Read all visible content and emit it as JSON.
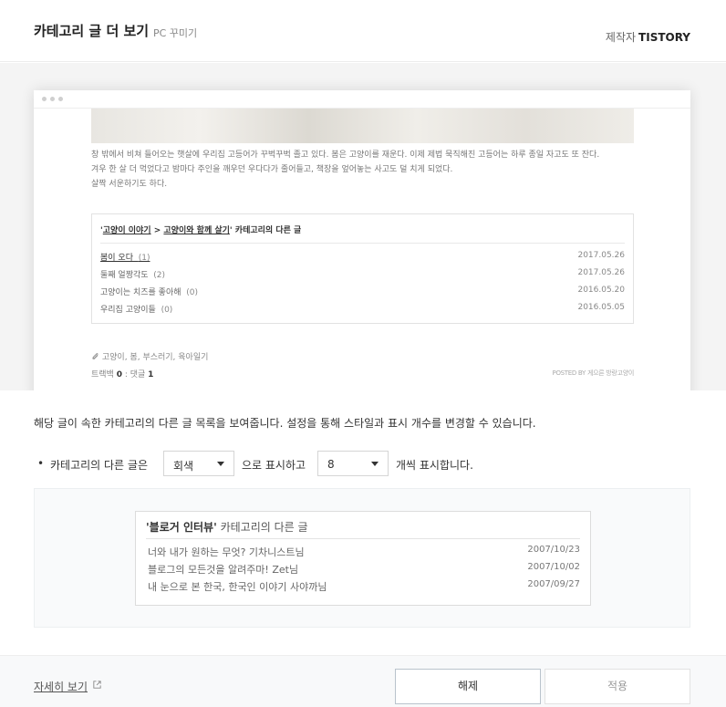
{
  "header": {
    "title": "카테고리 글 더 보기",
    "subtitle": "PC 꾸미기",
    "maker_label": "제작자",
    "maker_name": "TISTORY"
  },
  "preview": {
    "paragraph": [
      "창 밖에서 비쳐 들어오는 햇살에 우리집 고등어가 꾸벅꾸벅 졸고 있다. 봄은 고양이를 재운다. 이제 제법 묵직해진 고등어는 하루 종일 자고도 또 잔다.",
      "겨우 한 살 더 먹었다고 밤마다 주인을 깨우던 우다다가 줄어들고, 책장을 엎어놓는 사고도 덜 치게 되었다.",
      "살짝 서운하기도 하다."
    ],
    "related": {
      "category1": "고양이 이야기",
      "sep": " > ",
      "category2": "고양이와 함께 살기",
      "suffix": "' 카테고리의 다른 글",
      "items": [
        {
          "title": "봄이 오다",
          "count": "(1)",
          "date": "2017.05.26"
        },
        {
          "title": "둘째 얼짱각도",
          "count": "(2)",
          "date": "2017.05.26"
        },
        {
          "title": "고양이는 치즈를 좋아해",
          "count": "(0)",
          "date": "2016.05.20"
        },
        {
          "title": "우리집 고양이들",
          "count": "(0)",
          "date": "2016.05.05"
        }
      ]
    },
    "tags": "고양이, 봄, 부스러기, 육아일기",
    "trackback_label": "트랙백",
    "trackback_count": "0",
    "comment_label": " : 댓글 ",
    "comment_count": "1",
    "posted_by": "POSTED BY 게으른 방랑고양이"
  },
  "description": "해당 글이 속한 카테고리의 다른 글 목록을 보여줍니다. 설정을 통해 스타일과 표시 개수를 변경할 수 있습니다.",
  "setting": {
    "bullet": "•",
    "prefix": "카테고리의 다른 글은",
    "style_value": "회색",
    "middle": "으로 표시하고",
    "count_value": "8",
    "suffix": "개씩 표시합니다."
  },
  "sample": {
    "category": "'블로거 인터뷰'",
    "suffix": " 카테고리의 다른 글",
    "items": [
      {
        "title": "너와 내가 원하는 무엇? 기차니스트님",
        "date": "2007/10/23"
      },
      {
        "title": "블로그의 모든것을 알려주마! Zet님",
        "date": "2007/10/02"
      },
      {
        "title": "내 눈으로 본 한국, 한국인 이야기 사야까님",
        "date": "2007/09/27"
      }
    ]
  },
  "footer": {
    "more_label": "자세히 보기",
    "reset_label": "해제",
    "apply_label": "적용"
  },
  "colors": {
    "preview_bg": "#f4f4f4",
    "footer_bg": "#f8f9fa",
    "sample_bg": "#f9fafb"
  }
}
